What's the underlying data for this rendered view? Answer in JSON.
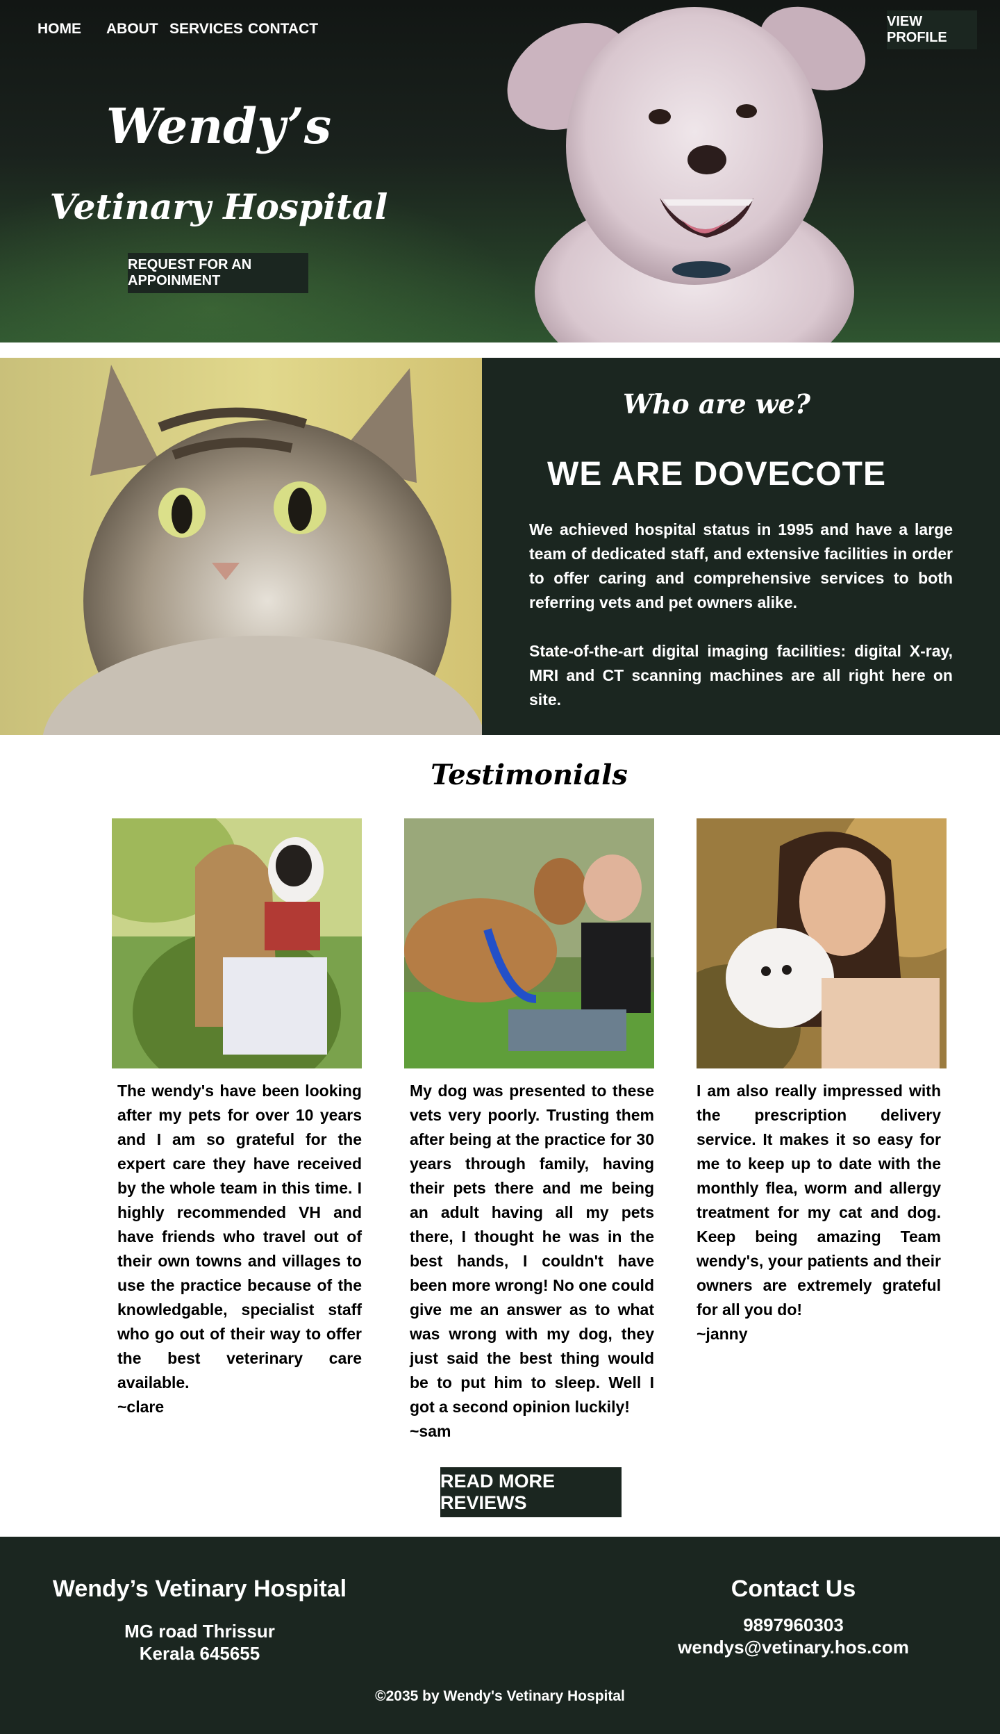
{
  "nav": {
    "home": "HOME",
    "about": "ABOUT",
    "services": "SERVICES",
    "contact": "CONTACT",
    "profile_button": "VIEW PROFILE"
  },
  "hero": {
    "title": "Wendy’s",
    "subtitle": "Vetinary Hospital",
    "cta": "REQUEST FOR AN APPOINMENT"
  },
  "about": {
    "heading": "Who are we?",
    "title": "WE ARE DOVECOTE",
    "paragraph1": "We achieved hospital status in 1995 and have a large team of dedicated staff, and extensive facilities in order to offer caring and comprehensive services to both referring vets and pet owners alike.",
    "paragraph2": "State-of-the-art digital imaging facilities: digital X-ray, MRI and CT scanning machines are all right here on site."
  },
  "testimonials": {
    "title": "Testimonials",
    "items": [
      {
        "text": "The wendy's have been looking after my pets for over 10 years and I am so grateful for the expert care they have received by the whole team in this time. I highly recommended VH and have friends who travel out of their own towns and villages to use the practice because of the knowledgable, specialist staff who go out of their way to offer the best veterinary care available.",
        "author": "~clare"
      },
      {
        "text": "My dog was presented to these vets very poorly. Trusting them after being at the practice for 30 years through family, having their pets there and me being an adult having all my pets there, I thought he was in the best hands, I couldn't have been more wrong! No one could give me an answer as to what was wrong with my dog, they just said the best thing would be to put him to sleep. Well I got a second opinion luckily!",
        "author": "~sam"
      },
      {
        "text": "I am also really impressed with the prescription delivery service. It makes it so easy for me to keep up to date with the monthly flea, worm and allergy treatment for my cat and dog. Keep being amazing Team wendy's, your patients and their owners are extremely grateful for all you do!",
        "author": "~janny"
      }
    ],
    "more_button": "READ MORE REVIEWS"
  },
  "footer": {
    "name": "Wendy’s Vetinary Hospital",
    "address_line1": "MG road Thrissur",
    "address_line2": "Kerala 645655",
    "contact_heading": "Contact Us",
    "phone": "9897960303",
    "email": "wendys@vetinary.hos.com",
    "copyright": "©2035 by Wendy's Vetinary Hospital"
  },
  "colors": {
    "dark_green": "#1b2620",
    "white": "#ffffff"
  }
}
